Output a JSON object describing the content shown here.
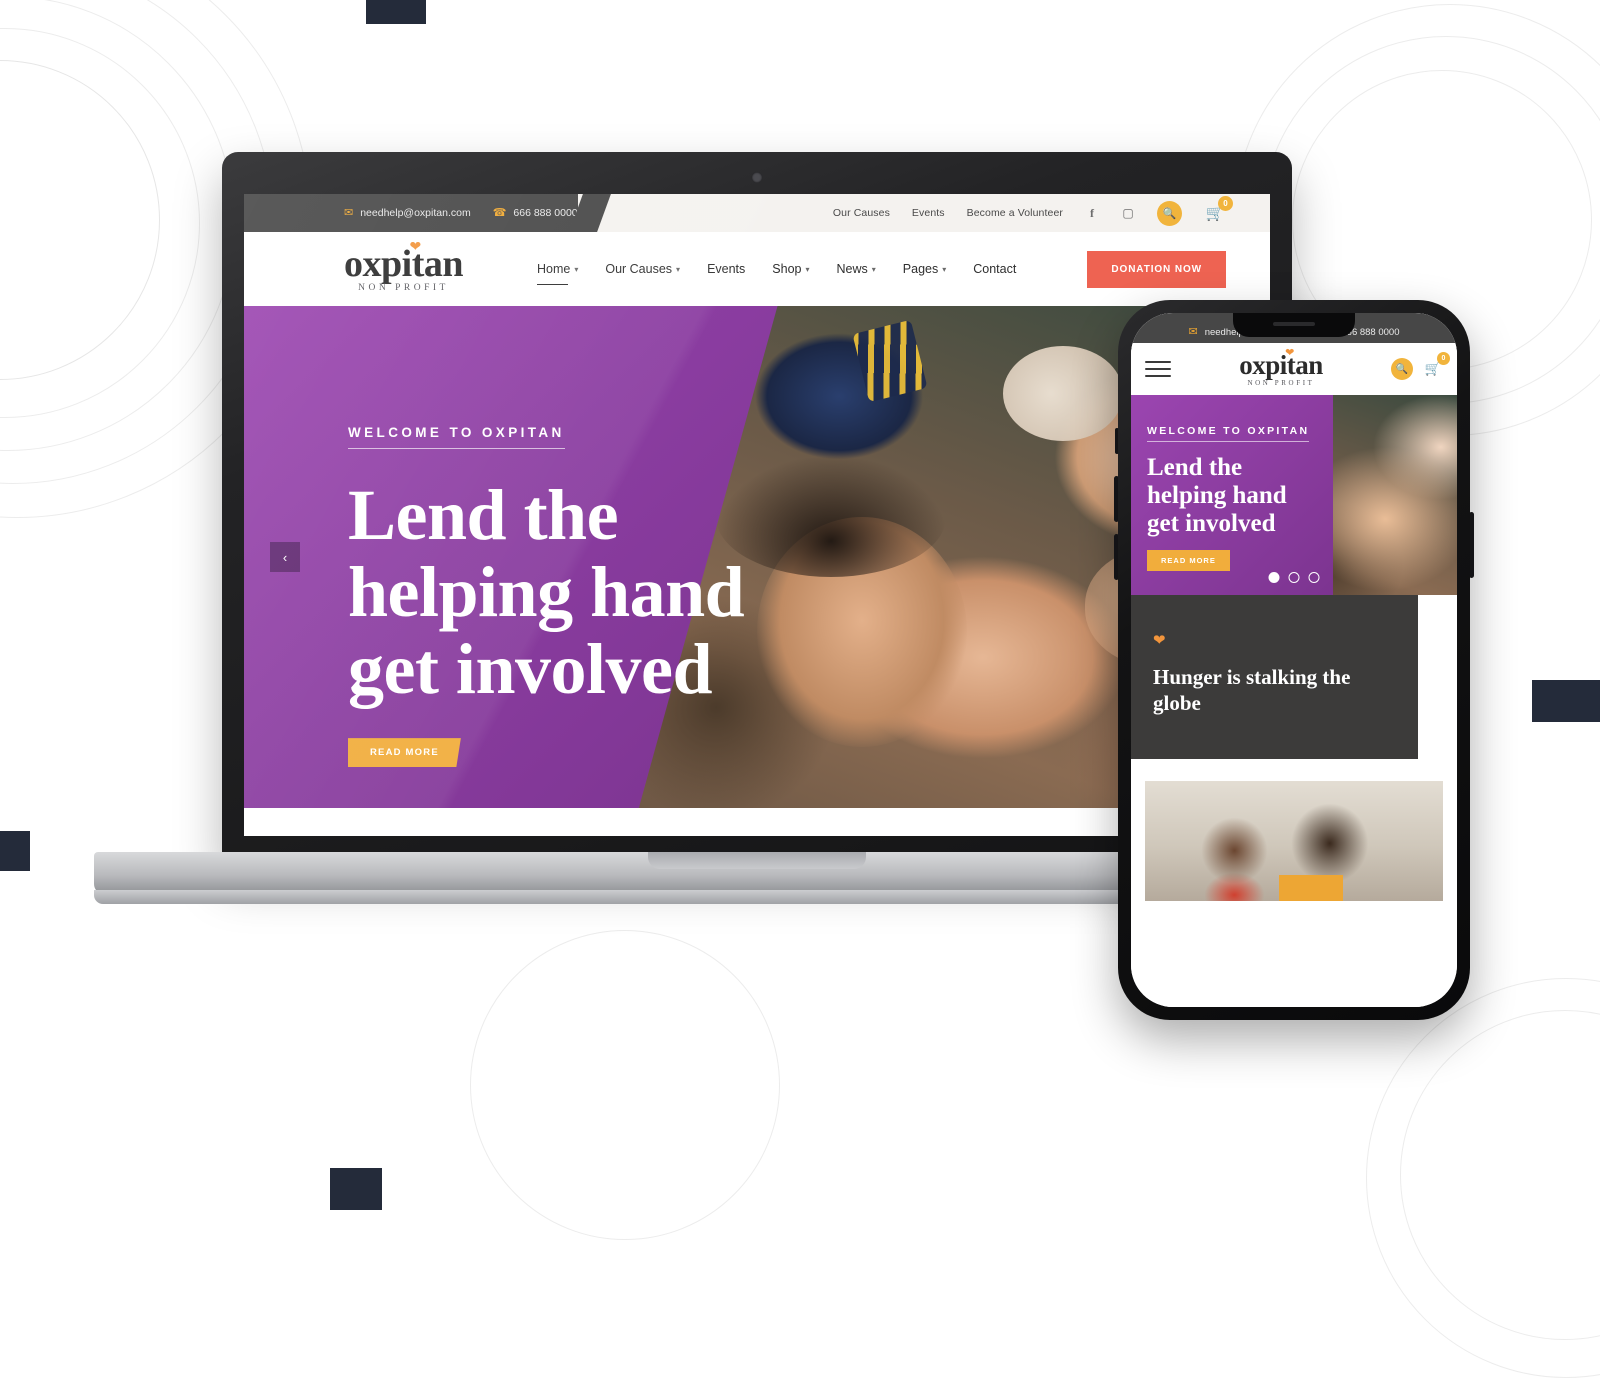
{
  "brand": {
    "name": "oxpitan",
    "tagline": "NON PROFIT",
    "heart_icon": "heart-icon",
    "accent_orange": "#f1b43c",
    "accent_coral": "#ee6352",
    "accent_purple": "#8b3da1",
    "dark": "#474747"
  },
  "desktop": {
    "topbar": {
      "email": "needhelp@oxpitan.com",
      "email_icon": "envelope-icon",
      "phone": "666 888 0000",
      "phone_icon": "phone-icon",
      "links": [
        "Our Causes",
        "Events",
        "Become a Volunteer"
      ],
      "social": [
        {
          "name": "facebook-icon",
          "glyph": "f"
        },
        {
          "name": "instagram-icon",
          "glyph": "▢"
        }
      ],
      "search_icon": "search-icon",
      "cart_icon": "cart-icon",
      "cart_count": "0"
    },
    "nav": [
      {
        "label": "Home",
        "dropdown": true,
        "active": true
      },
      {
        "label": "Our Causes",
        "dropdown": true,
        "active": false
      },
      {
        "label": "Events",
        "dropdown": false,
        "active": false
      },
      {
        "label": "Shop",
        "dropdown": true,
        "active": false
      },
      {
        "label": "News",
        "dropdown": true,
        "active": false
      },
      {
        "label": "Pages",
        "dropdown": true,
        "active": false
      },
      {
        "label": "Contact",
        "dropdown": false,
        "active": false
      }
    ],
    "donate_button": "DONATION NOW",
    "hero": {
      "kicker": "WELCOME TO OXPITAN",
      "title_line1": "Lend the",
      "title_line2": "helping hand",
      "title_line3": "get involved",
      "button": "READ MORE",
      "prev_arrow": "‹"
    }
  },
  "mobile": {
    "topbar": {
      "email": "needhelp@oxpitan.com",
      "phone": "666 888 0000"
    },
    "menu_icon": "hamburger-menu-icon",
    "search_icon": "search-icon",
    "cart_icon": "cart-icon",
    "cart_count": "0",
    "hero": {
      "kicker": "WELCOME TO OXPITAN",
      "title_line1": "Lend the",
      "title_line2": "helping hand",
      "title_line3": "get involved",
      "button": "READ MORE",
      "slides_total": 3,
      "active_slide": 1
    },
    "feature": {
      "heart_icon": "heart-icon",
      "title": "Hunger is stalking the globe"
    }
  }
}
